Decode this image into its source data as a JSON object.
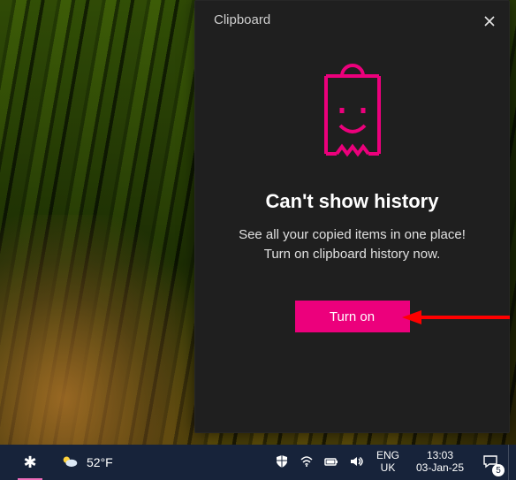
{
  "panel": {
    "title": "Clipboard",
    "heading": "Can't show history",
    "subtext_line1": "See all your copied items in one place!",
    "subtext_line2": "Turn on clipboard history now.",
    "button_label": "Turn on",
    "accent_color": "#ec007c"
  },
  "taskbar": {
    "weather_temp": "52°F",
    "language_primary": "ENG",
    "language_secondary": "UK",
    "clock_time": "13:03",
    "clock_date": "03-Jan-25",
    "notification_count": "5"
  }
}
